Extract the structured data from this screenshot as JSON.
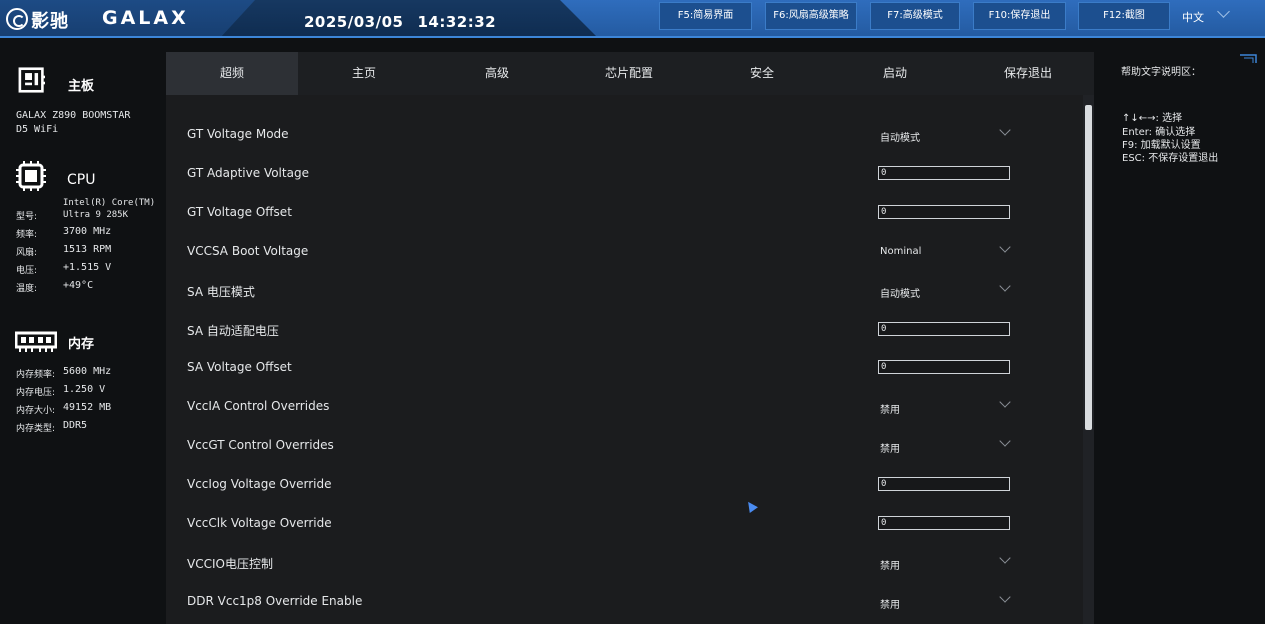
{
  "header": {
    "brand_cn": "影驰",
    "brand_en": "GALAX",
    "date": "2025/03/05",
    "time": "14:32:32",
    "function_keys": [
      {
        "label": "F5:简易界面"
      },
      {
        "label": "F6:风扇高级策略"
      },
      {
        "label": "F7:高级模式"
      },
      {
        "label": "F10:保存退出"
      },
      {
        "label": "F12:截图"
      }
    ],
    "language": "中文"
  },
  "sidebar": {
    "board": {
      "title": "主板",
      "model_line1": "GALAX Z890 BOOMSTAR",
      "model_line2": "D5 WiFi"
    },
    "cpu": {
      "title": "CPU",
      "model_label": "型号:",
      "model_line1": "Intel(R) Core(TM)",
      "model_line2": "Ultra 9 285K",
      "freq_label": "频率:",
      "freq_value": "3700 MHz",
      "fan_label": "风扇:",
      "fan_value": "1513 RPM",
      "voltage_label": "电压:",
      "voltage_value": "+1.515 V",
      "temp_label": "温度:",
      "temp_value": "+49°C"
    },
    "memory": {
      "title": "内存",
      "freq_label": "内存频率:",
      "freq_value": "5600 MHz",
      "voltage_label": "内存电压:",
      "voltage_value": "1.250 V",
      "size_label": "内存大小:",
      "size_value": "49152 MB",
      "type_label": "内存类型:",
      "type_value": "DDR5"
    }
  },
  "tabs": [
    {
      "label": "超频",
      "active": true
    },
    {
      "label": "主页",
      "active": false
    },
    {
      "label": "高级",
      "active": false
    },
    {
      "label": "芯片配置",
      "active": false
    },
    {
      "label": "安全",
      "active": false
    },
    {
      "label": "启动",
      "active": false
    },
    {
      "label": "保存退出",
      "active": false
    }
  ],
  "settings": [
    {
      "label": "GT Voltage Mode",
      "kind": "select",
      "value": "自动模式"
    },
    {
      "label": "GT Adaptive Voltage",
      "kind": "input",
      "value": "0"
    },
    {
      "label": "GT Voltage Offset",
      "kind": "input",
      "value": "0"
    },
    {
      "label": "VCCSA Boot Voltage",
      "kind": "select",
      "value": "Nominal"
    },
    {
      "label": "SA 电压模式",
      "kind": "select",
      "value": "自动模式"
    },
    {
      "label": "SA 自动适配电压",
      "kind": "input",
      "value": "0"
    },
    {
      "label": "SA Voltage Offset",
      "kind": "input",
      "value": "0"
    },
    {
      "label": "VccIA Control Overrides",
      "kind": "select",
      "value": "禁用"
    },
    {
      "label": "VccGT Control Overrides",
      "kind": "select",
      "value": "禁用"
    },
    {
      "label": "VccIog Voltage Override",
      "kind": "input",
      "value": "0"
    },
    {
      "label": "VccClk Voltage Override",
      "kind": "input",
      "value": "0"
    },
    {
      "label": "VCCIO电压控制",
      "kind": "select",
      "value": "禁用"
    },
    {
      "label": "DDR Vcc1p8 Override Enable",
      "kind": "select",
      "value": "禁用"
    }
  ],
  "help": {
    "title": "帮助文字说明区：",
    "lines": [
      "↑↓←→:  选择",
      "Enter:  确认选择",
      "F9:  加载默认设置",
      "ESC:  不保存设置退出"
    ]
  },
  "colors": {
    "header_blue": "#2a66b3",
    "header_dark": "#163861",
    "panel_bg": "#1b1c1e",
    "active_tab": "#2d3035"
  }
}
